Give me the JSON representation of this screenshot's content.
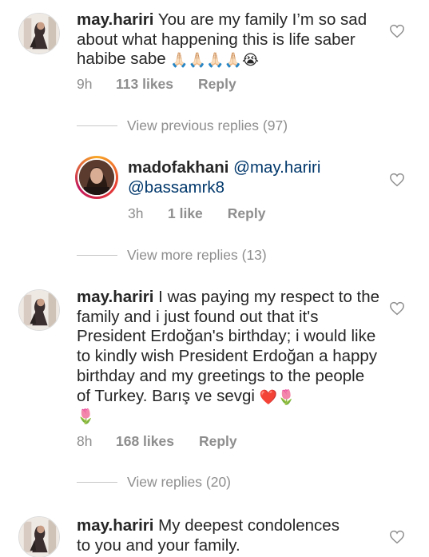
{
  "comments": [
    {
      "username": "may.hariri",
      "text": " You are my family I’m so sad about what happening  this is life saber habibe sabe ",
      "emoji": "🙏🏻🙏🏻🙏🏻🙏🏻😭",
      "time": "9h",
      "likes": "113 likes",
      "reply": "Reply"
    },
    {
      "view_replies": "View previous replies (97)"
    },
    {
      "username": "madofakhani",
      "mention1": "@may.hariri",
      "mention2": "@bassamrk8",
      "time": "3h",
      "likes": "1 like",
      "reply": "Reply"
    },
    {
      "view_replies": "View more replies (13)"
    },
    {
      "username": "may.hariri",
      "text": " I was paying my respect to the family and i just found out that it's President Erdoğan's birthday; i would like to kindly wish President Erdoğan a happy birthday and my greetings to the people of Turkey. Barış ve sevgi ",
      "emoji": "❤️🌷",
      "emoji2": "🌷",
      "time": "8h",
      "likes": "168 likes",
      "reply": "Reply"
    },
    {
      "view_replies": "View replies (20)"
    },
    {
      "username": "may.hariri",
      "text": " My deepest condolences to you and your family."
    }
  ],
  "icons": {
    "like": "heart-outline-icon",
    "avatar": "profile-picture"
  },
  "colors": {
    "text": "#262626",
    "meta": "#8e8e8e",
    "mention": "#00376b"
  }
}
